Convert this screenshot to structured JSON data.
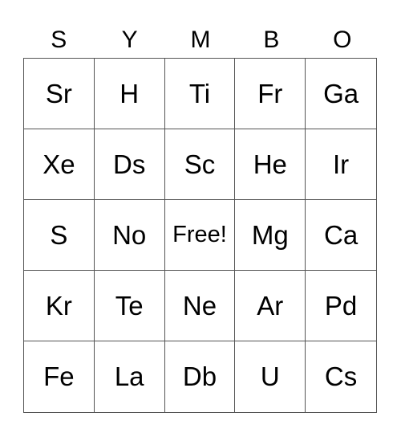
{
  "header": [
    "S",
    "Y",
    "M",
    "B",
    "O"
  ],
  "cells": [
    "Sr",
    "H",
    "Ti",
    "Fr",
    "Ga",
    "Xe",
    "Ds",
    "Sc",
    "He",
    "Ir",
    "S",
    "No",
    "Free!",
    "Mg",
    "Ca",
    "Kr",
    "Te",
    "Ne",
    "Ar",
    "Pd",
    "Fe",
    "La",
    "Db",
    "U",
    "Cs"
  ],
  "free_index": 12
}
